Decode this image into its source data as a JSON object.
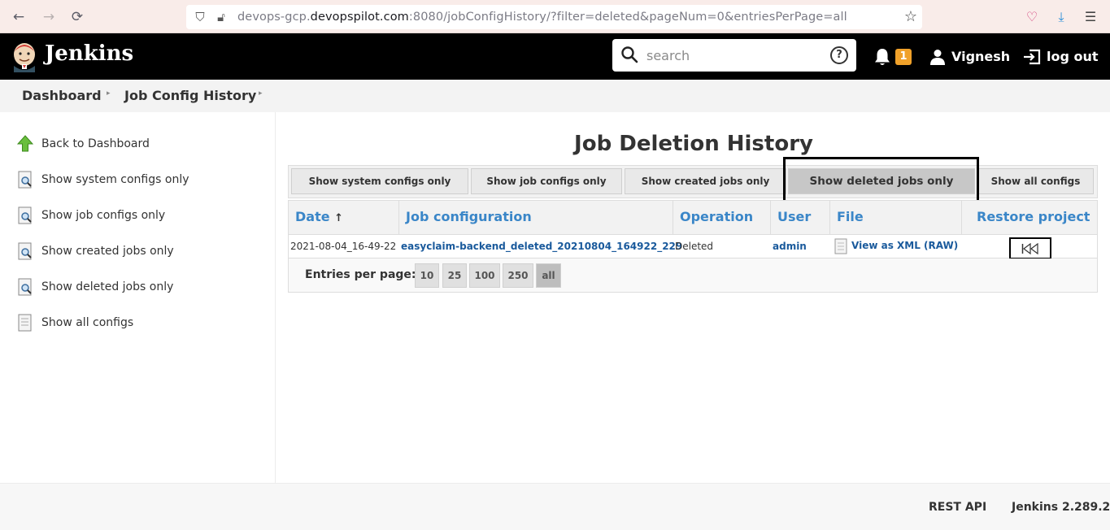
{
  "browser": {
    "url_prefix": "devops-gcp.",
    "url_domain": "devopspilot.com",
    "url_rest": ":8080/jobConfigHistory/?filter=deleted&pageNum=0&entriesPerPage=all"
  },
  "header": {
    "brand": "Jenkins",
    "search_placeholder": "search",
    "help_glyph": "?",
    "notification_count": "1",
    "user_name": "Vignesh",
    "logout_label": "log out"
  },
  "breadcrumb": {
    "items": [
      "Dashboard",
      "Job Config History"
    ]
  },
  "sidebar": {
    "items": [
      {
        "label": "Back to Dashboard",
        "icon": "up-arrow-icon"
      },
      {
        "label": "Show system configs only",
        "icon": "search-document-icon"
      },
      {
        "label": "Show job configs only",
        "icon": "search-document-icon"
      },
      {
        "label": "Show created jobs only",
        "icon": "search-document-icon"
      },
      {
        "label": "Show deleted jobs only",
        "icon": "search-document-icon"
      },
      {
        "label": "Show all configs",
        "icon": "document-icon"
      }
    ]
  },
  "main": {
    "title": "Job Deletion History",
    "filters": [
      "Show system configs only",
      "Show job configs only",
      "Show created jobs only",
      "Show deleted jobs only",
      "Show all configs"
    ],
    "active_filter": "Show deleted jobs only",
    "table": {
      "headers": {
        "date": "Date",
        "sort_glyph": "↑",
        "job": "Job configuration",
        "operation": "Operation",
        "user": "User",
        "file": "File",
        "restore": "Restore project"
      },
      "rows": [
        {
          "date": "2021-08-04_16-49-22",
          "job": "easyclaim-backend_deleted_20210804_164922_229",
          "operation": "Deleted",
          "user": "admin",
          "file_xml": "View as XML",
          "file_raw": "(RAW)",
          "restore_icon": "restore-icon"
        }
      ]
    },
    "entries": {
      "label": "Entries per page:",
      "options": [
        "10",
        "25",
        "100",
        "250",
        "all"
      ],
      "selected": "all"
    }
  },
  "footer": {
    "rest_api": "REST API",
    "version": "Jenkins 2.289.2"
  },
  "colors": {
    "header_bg": "#000000",
    "link_blue": "#3a86c8",
    "badge_orange": "#f0a12a"
  }
}
